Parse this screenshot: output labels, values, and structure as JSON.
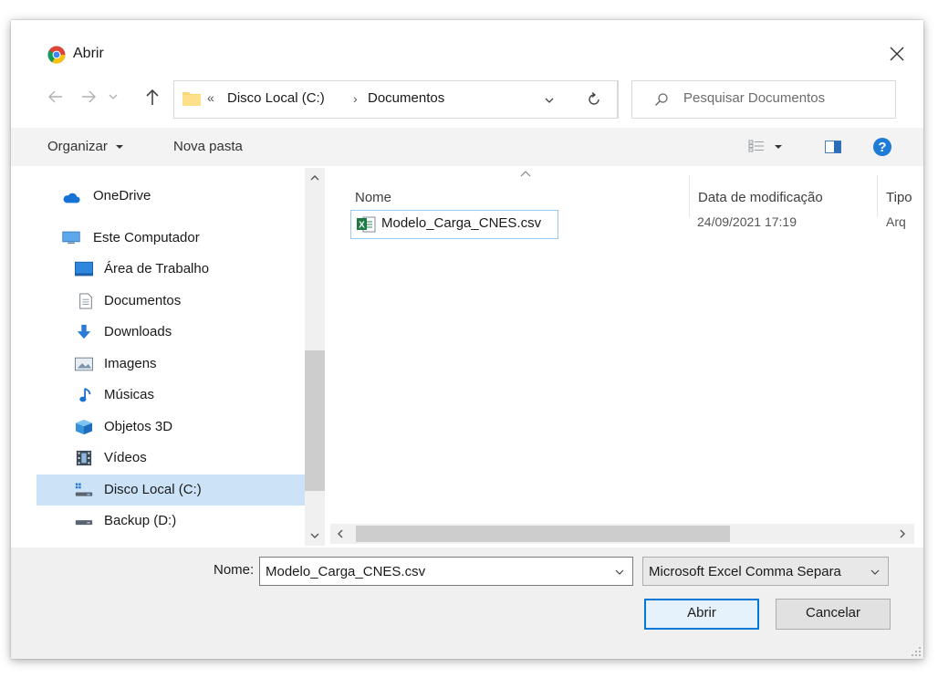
{
  "window": {
    "title": "Abrir"
  },
  "nav": {
    "breadcrumb": [
      "Disco Local (C:)",
      "Documentos"
    ],
    "breadcrumb_overflow": "«",
    "search_placeholder": "Pesquisar Documentos"
  },
  "toolbar": {
    "organize": "Organizar",
    "new_folder": "Nova pasta"
  },
  "sidebar": {
    "items": [
      {
        "label": "OneDrive",
        "icon": "cloud-icon"
      },
      {
        "label": "Este Computador",
        "icon": "computer-icon"
      },
      {
        "label": "Área de Trabalho",
        "icon": "desktop-icon"
      },
      {
        "label": "Documentos",
        "icon": "document-icon"
      },
      {
        "label": "Downloads",
        "icon": "download-icon"
      },
      {
        "label": "Imagens",
        "icon": "pictures-icon"
      },
      {
        "label": "Músicas",
        "icon": "music-icon"
      },
      {
        "label": "Objetos 3D",
        "icon": "objects-3d-icon"
      },
      {
        "label": "Vídeos",
        "icon": "videos-icon"
      },
      {
        "label": "Disco Local (C:)",
        "icon": "drive-windows-icon",
        "selected": true
      },
      {
        "label": "Backup (D:)",
        "icon": "drive-icon"
      }
    ]
  },
  "file_list": {
    "columns": [
      "Nome",
      "Data de modificação",
      "Tipo"
    ],
    "rows": [
      {
        "name": "Modelo_Carga_CNES.csv",
        "modified": "24/09/2021 17:19",
        "type": "Arq",
        "icon": "excel-csv-icon"
      }
    ]
  },
  "footer": {
    "name_label": "Nome:",
    "filename_value": "Modelo_Carga_CNES.csv",
    "file_type": "Microsoft Excel Comma Separa",
    "open_label": "Abrir",
    "cancel_label": "Cancelar"
  },
  "colors": {
    "accent": "#0078d7",
    "selection": "#cce3f7",
    "help": "#1e7bd6"
  }
}
